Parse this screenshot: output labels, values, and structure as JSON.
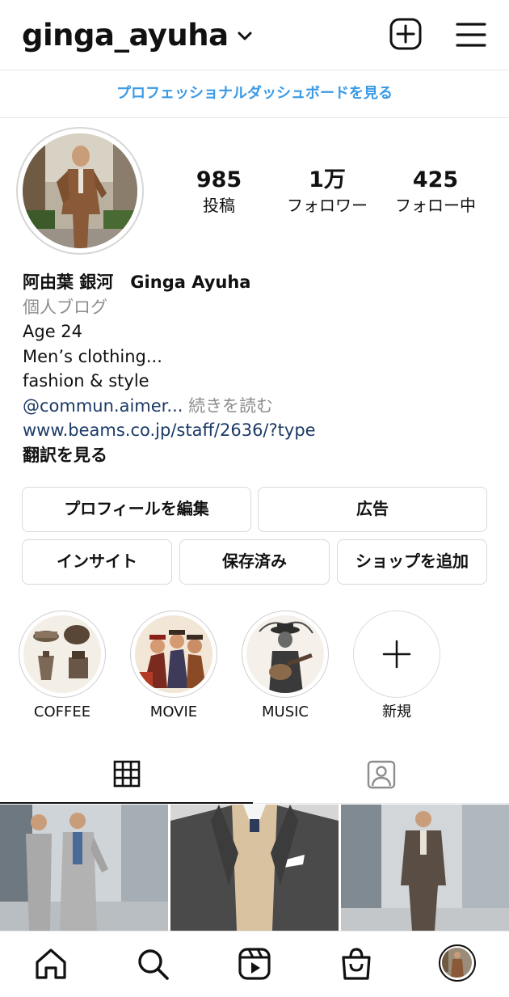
{
  "header": {
    "username": "ginga_ayuha"
  },
  "dashboard": {
    "label": "プロフェッショナルダッシュボードを見る"
  },
  "stats": [
    {
      "value": "985",
      "label": "投稿"
    },
    {
      "value": "1万",
      "label": "フォロワー"
    },
    {
      "value": "425",
      "label": "フォロー中"
    }
  ],
  "bio": {
    "name": "阿由葉 銀河　Ginga Ayuha",
    "category": "個人ブログ",
    "lines": [
      "Age 24",
      "Men’s clothing...",
      "fashion & style"
    ],
    "mention": "@commun.aimer...",
    "more": "続きを読む",
    "url": "www.beams.co.jp/staff/2636/?type",
    "translate": "翻訳を見る"
  },
  "buttons": {
    "edit_profile": "プロフィールを編集",
    "ads": "広告",
    "insights": "インサイト",
    "saved": "保存済み",
    "add_shop": "ショップを追加"
  },
  "highlights": [
    {
      "label": "COFFEE"
    },
    {
      "label": "MOVIE"
    },
    {
      "label": "MUSIC"
    },
    {
      "label": "新規"
    }
  ],
  "colors": {
    "link": "#3a9ae6",
    "border": "#d9d9d9",
    "active_tab": "#111111"
  }
}
